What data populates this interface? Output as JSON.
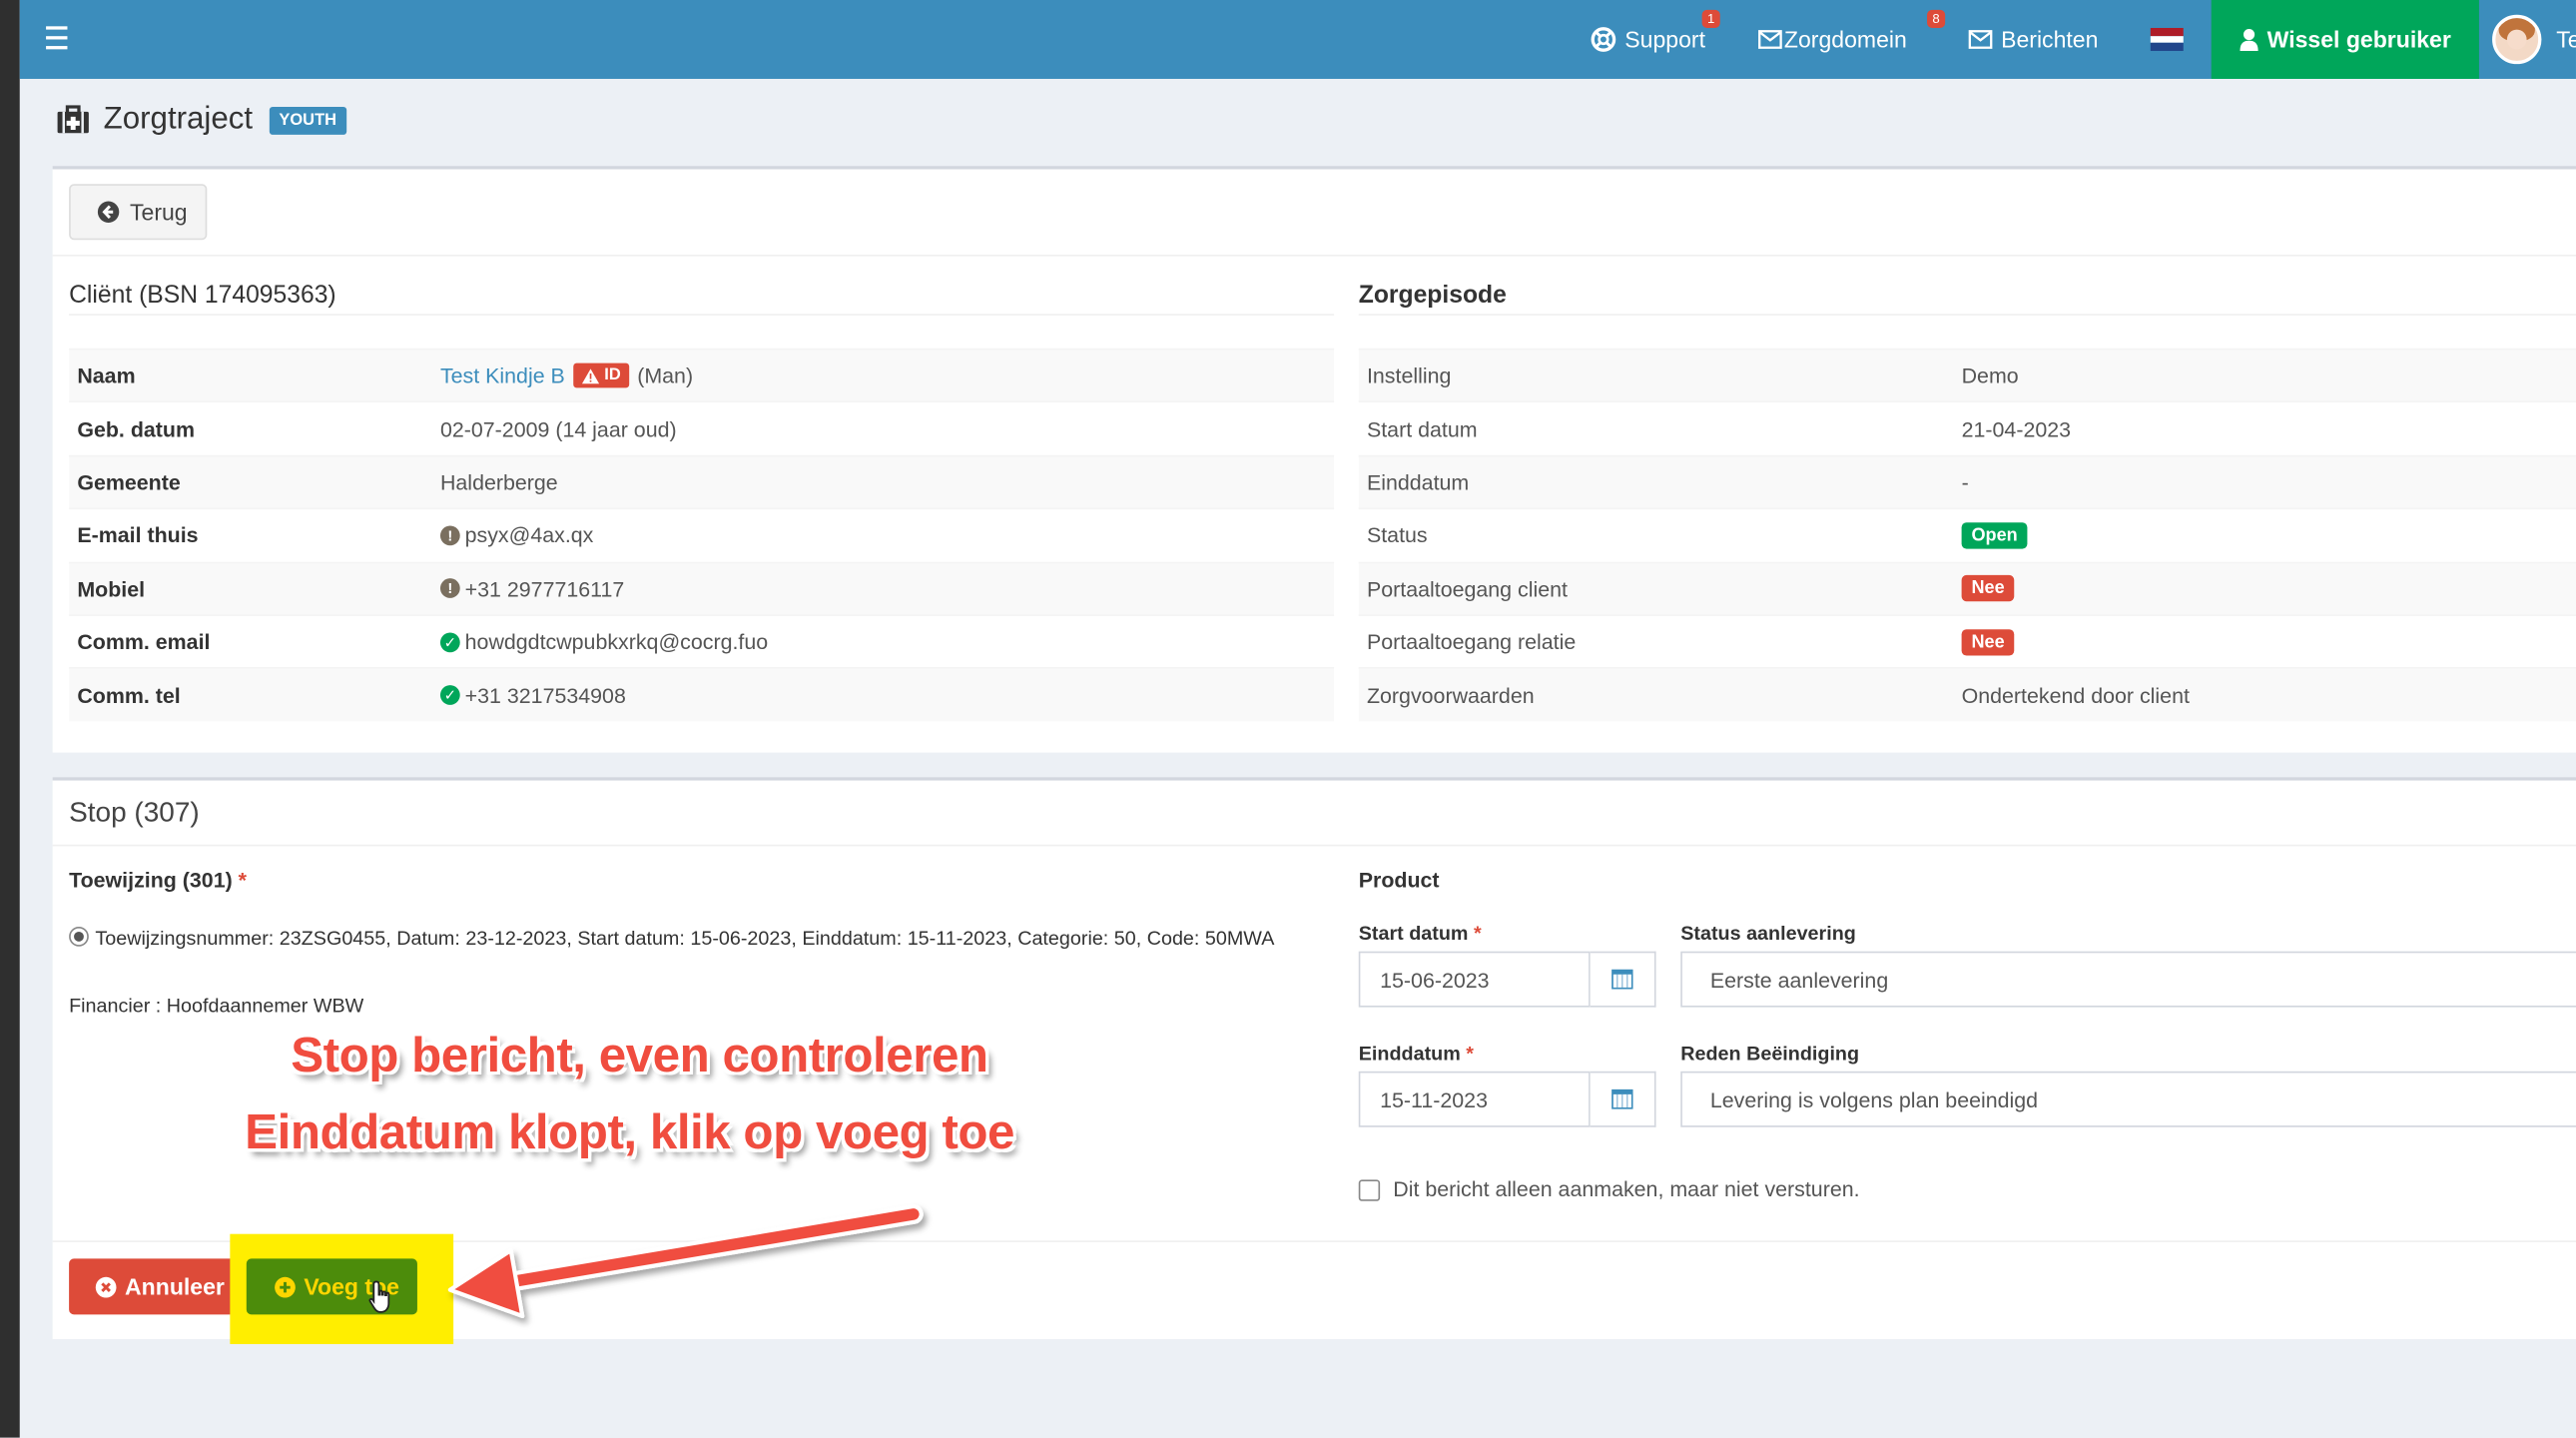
{
  "nav": {
    "support_label": "Support",
    "support_count": "1",
    "zorgdomein_label": "Zorgdomein",
    "zorgdomein_count": "8",
    "berichten_label": "Berichten",
    "wissel_label": "Wissel gebruiker",
    "user_label": "Te"
  },
  "page": {
    "title": "Zorgtraject",
    "badge": "YOUTH",
    "back_label": "Terug"
  },
  "client": {
    "title": "Cliënt (BSN 174095363)",
    "rows": [
      {
        "label": "Naam",
        "name_link": "Test Kindje B",
        "badge": "ID",
        "suffix": "(Man)"
      },
      {
        "label": "Geb. datum",
        "value": "02-07-2009 (14 jaar oud)"
      },
      {
        "label": "Gemeente",
        "value": "Halderberge"
      },
      {
        "label": "E-mail thuis",
        "value": "psyx@4ax.qx",
        "status": "unverified"
      },
      {
        "label": "Mobiel",
        "value": "+31 2977716117",
        "status": "unverified"
      },
      {
        "label": "Comm. email",
        "value": "howdgdtcwpubkxrkq@cocrg.fuo",
        "status": "verified"
      },
      {
        "label": "Comm. tel",
        "value": "+31 3217534908",
        "status": "verified"
      }
    ]
  },
  "zorgepisode": {
    "title": "Zorgepisode",
    "rows": [
      {
        "label": "Instelling",
        "value": "Demo"
      },
      {
        "label": "Start datum",
        "value": "21-04-2023"
      },
      {
        "label": "Einddatum",
        "value": "-"
      },
      {
        "label": "Status",
        "pill": "Open",
        "pill_color": "#00a65a"
      },
      {
        "label": "Portaaltoegang client",
        "pill": "Nee",
        "pill_color": "#dd4b39"
      },
      {
        "label": "Portaaltoegang relatie",
        "pill": "Nee",
        "pill_color": "#dd4b39"
      },
      {
        "label": "Zorgvoorwaarden",
        "value": "Ondertekend door client"
      }
    ]
  },
  "stop": {
    "title": "Stop (307)",
    "toewijzing_label": "Toewijzing (301)",
    "required_mark": "*",
    "toewijzing_line": "Toewijzingsnummer: 23ZSG0455, Datum: 23-12-2023, Start datum: 15-06-2023, Einddatum: 15-11-2023, Categorie: 50, Code: 50MWA",
    "financier": "Financier : Hoofdaannemer WBW",
    "product_label": "Product",
    "start_label": "Start datum",
    "start_value": "15-06-2023",
    "status_label": "Status aanlevering",
    "status_value": "Eerste aanlevering",
    "eind_label": "Einddatum",
    "eind_value": "15-11-2023",
    "reden_label": "Reden Beëindiging",
    "reden_value": "Levering is volgens plan beeindigd",
    "checkbox_label": "Dit bericht alleen aanmaken, maar niet versturen.",
    "cancel_label": "Annuleer",
    "add_label": "Voeg toe"
  },
  "annotation": {
    "line1": "Stop bericht, even controleren",
    "line2": "Einddatum klopt, klik op voeg toe",
    "color": "#f04d3f",
    "highlight_color": "#ffee00"
  }
}
